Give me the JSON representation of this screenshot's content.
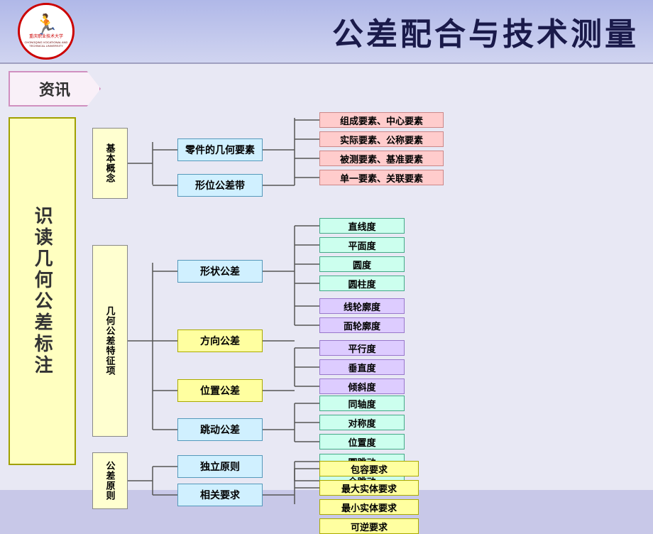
{
  "header": {
    "title": "公差配合与技术测量",
    "logo_text_cn": "重庆职业技术大学",
    "logo_text_en": "CHONGQING VOCATIONAL AND TECHNICAL UNIVERSITY"
  },
  "zixun": "资讯",
  "main_title": "识读几何公差标注",
  "tree": {
    "l1_boxes": [
      {
        "id": "jiben",
        "label": "基本概念"
      },
      {
        "id": "jihe",
        "label": "几何公差特征项"
      },
      {
        "id": "gongli",
        "label": "公差原则"
      }
    ],
    "jiben_children": [
      {
        "label": "零件的几何要素"
      },
      {
        "label": "形位公差带"
      }
    ],
    "jiben_grandchildren": [
      {
        "label": "组成要素、中心要素"
      },
      {
        "label": "实际要素、公称要素"
      },
      {
        "label": "被测要素、基准要素"
      },
      {
        "label": "单一要素、关联要素"
      }
    ],
    "jihe_children": [
      {
        "label": "形状公差"
      },
      {
        "label": "方向公差"
      },
      {
        "label": "位置公差"
      },
      {
        "label": "跳动公差"
      }
    ],
    "xingzhuang_children": [
      {
        "label": "直线度"
      },
      {
        "label": "平面度"
      },
      {
        "label": "圆度"
      },
      {
        "label": "圆柱度"
      }
    ],
    "fangxiang_children": [
      {
        "label": "线轮廓度"
      },
      {
        "label": "面轮廓度"
      },
      {
        "label": "平行度"
      },
      {
        "label": "垂直度"
      },
      {
        "label": "倾斜度"
      }
    ],
    "weizhi_children": [
      {
        "label": "同轴度"
      },
      {
        "label": "对称度"
      },
      {
        "label": "位置度"
      }
    ],
    "tiaodong_children": [
      {
        "label": "圆跳动"
      },
      {
        "label": "全跳动"
      }
    ],
    "gongli_children": [
      {
        "label": "独立原则"
      },
      {
        "label": "相关要求"
      }
    ],
    "xiangguan_children": [
      {
        "label": "包容要求"
      },
      {
        "label": "最大实体要求"
      },
      {
        "label": "最小实体要求"
      },
      {
        "label": "可逆要求"
      }
    ]
  }
}
